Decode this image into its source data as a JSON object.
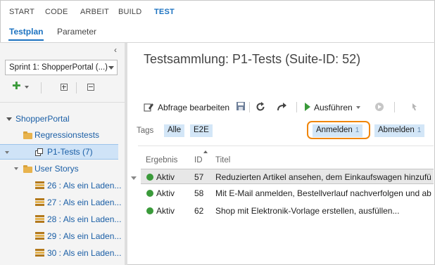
{
  "topnav": {
    "items": [
      {
        "label": "START"
      },
      {
        "label": "CODE"
      },
      {
        "label": "ARBEIT"
      },
      {
        "label": "BUILD"
      },
      {
        "label": "TEST"
      }
    ],
    "active": "TEST"
  },
  "subnav": {
    "items": [
      {
        "label": "Testplan"
      },
      {
        "label": "Parameter"
      }
    ],
    "active": "Testplan"
  },
  "sidebar": {
    "collapse_icon": "chevron-left-icon",
    "sprint_select": {
      "value": "Sprint 1: ShopperPortal (...)"
    },
    "toolbar": [
      "plus-icon",
      "expand-all-icon",
      "collapse-all-icon"
    ],
    "tree": {
      "root": "ShopperPortal",
      "items": [
        {
          "label": "Regressionstests",
          "icon": "folder-icon"
        },
        {
          "label": "P1-Tests (7)",
          "icon": "test-suite-icon",
          "selected": true
        },
        {
          "label": "User Storys",
          "icon": "folder-icon"
        }
      ],
      "stories": [
        {
          "label": "26 : Als ein Laden..."
        },
        {
          "label": "27 : Als ein Laden..."
        },
        {
          "label": "28 : Als ein Laden..."
        },
        {
          "label": "29 : Als ein Laden..."
        },
        {
          "label": "30 : Als ein Laden..."
        }
      ]
    }
  },
  "main": {
    "title": "Testsammlung: P1-Tests (Suite-ID: 52)",
    "toolbar": {
      "edit_query_label": "Abfrage bearbeiten",
      "run_label": "Ausführen"
    },
    "tags": {
      "label": "Tags",
      "items": [
        {
          "label": "Alle"
        },
        {
          "label": "E2E"
        },
        {
          "label": "Anmelden",
          "count": "1",
          "highlighted": true
        },
        {
          "label": "Abmelden",
          "count": "1"
        }
      ]
    },
    "grid": {
      "columns": [
        "Ergebnis",
        "ID",
        "Titel"
      ],
      "rows": [
        {
          "result": "Aktiv",
          "id": "57",
          "title": "Reduzierten Artikel ansehen, dem Einkaufswagen hinzufü...",
          "selected": true
        },
        {
          "result": "Aktiv",
          "id": "58",
          "title": "Mit E-Mail anmelden, Bestellverlauf nachverfolgen und ab..."
        },
        {
          "result": "Aktiv",
          "id": "62",
          "title": "Shop mit Elektronik-Vorlage erstellen, ausfüllen..."
        }
      ]
    }
  },
  "colors": {
    "accent": "#1b72c0",
    "active_dot": "#3a9a3a",
    "tag_bg": "#d3e6f7",
    "highlight_ring": "#f0860b",
    "folder": "#e8b34d"
  }
}
